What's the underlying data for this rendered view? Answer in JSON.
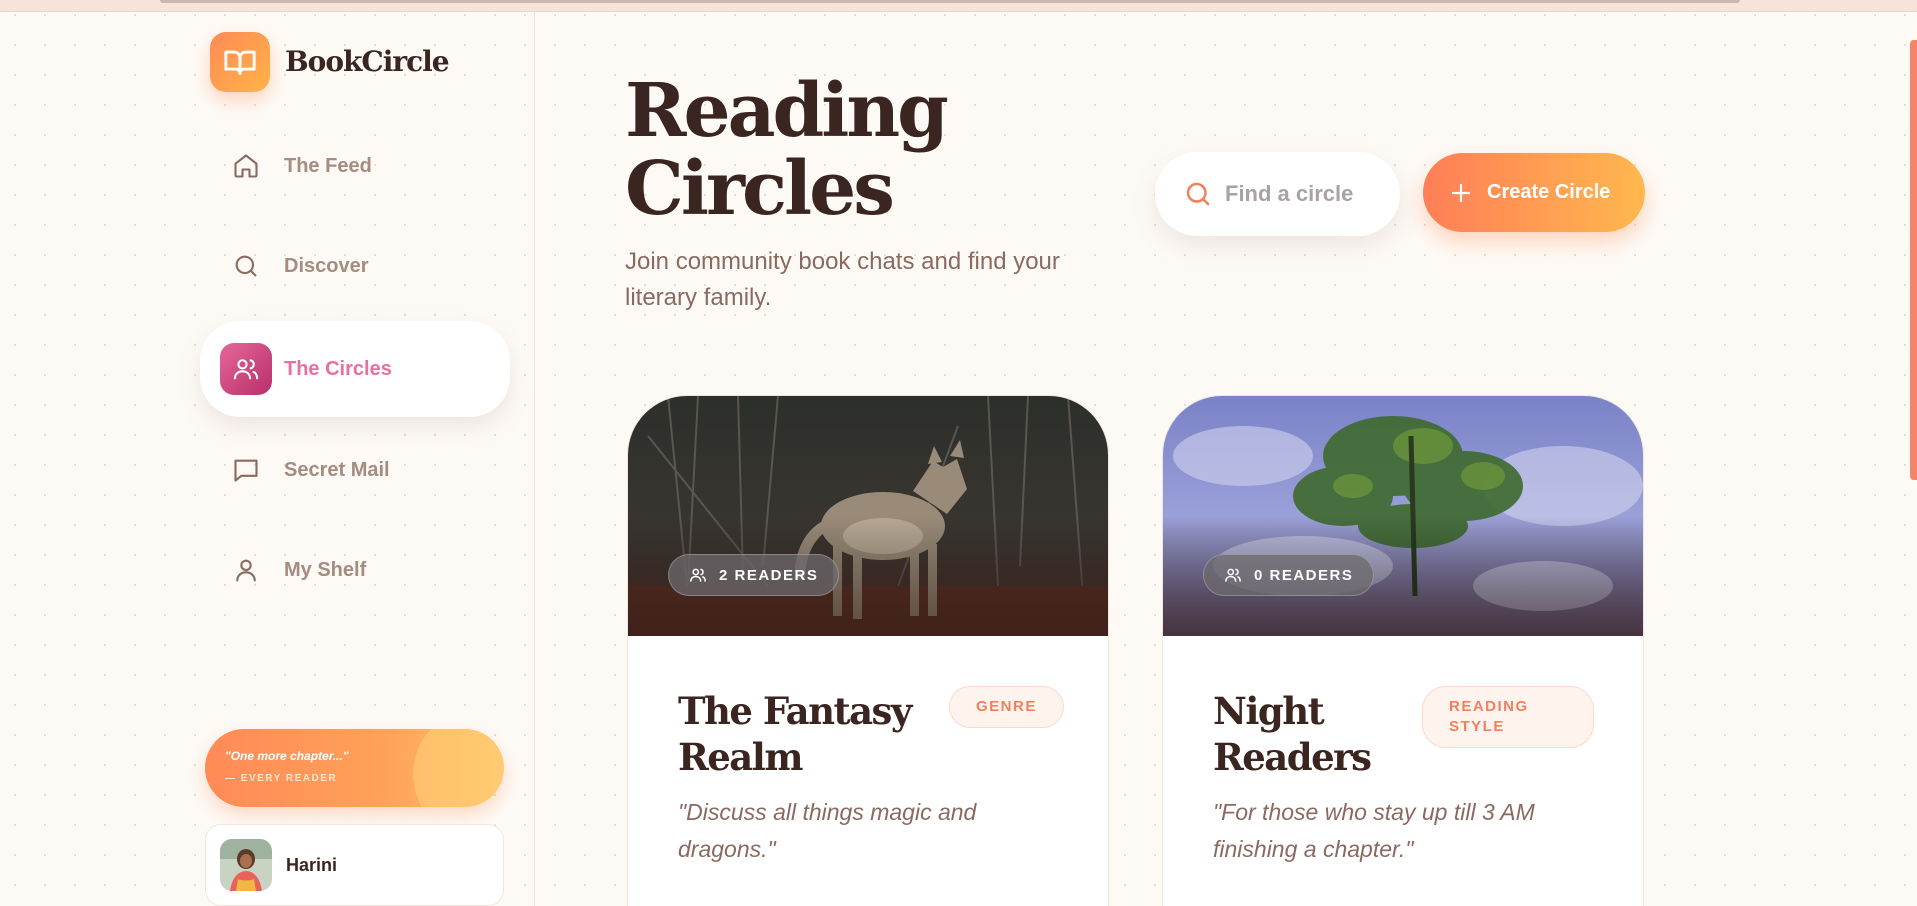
{
  "app": {
    "name": "BookCircle"
  },
  "nav": [
    {
      "label": "The Feed",
      "icon": "home-icon",
      "active": false
    },
    {
      "label": "Discover",
      "icon": "search-icon",
      "active": false
    },
    {
      "label": "The Circles",
      "icon": "users-icon",
      "active": true
    },
    {
      "label": "Secret Mail",
      "icon": "message-icon",
      "active": false
    },
    {
      "label": "My Shelf",
      "icon": "user-icon",
      "active": false
    }
  ],
  "quote": {
    "text": "\"One more chapter...\"",
    "author": "— EVERY READER"
  },
  "user": {
    "name": "Harini"
  },
  "header": {
    "title": "Reading Circles",
    "subtitle": "Join community book chats and find your literary family."
  },
  "search": {
    "placeholder": "Find a circle",
    "value": ""
  },
  "create": {
    "label": "Create Circle"
  },
  "circles": [
    {
      "title": "The Fantasy Realm",
      "tag": "GENRE",
      "readers": "2 READERS",
      "description": "\"Discuss all things magic and dragons.\""
    },
    {
      "title": "Night Readers",
      "tag": "READING STYLE",
      "readers": "0 READERS",
      "description": "\"For those who stay up till 3 AM finishing a chapter.\""
    }
  ],
  "colors": {
    "accent_orange": "#ff8a57",
    "accent_pink": "#e9709e",
    "text_dark": "#3b2520",
    "text_muted": "#a58b80"
  }
}
